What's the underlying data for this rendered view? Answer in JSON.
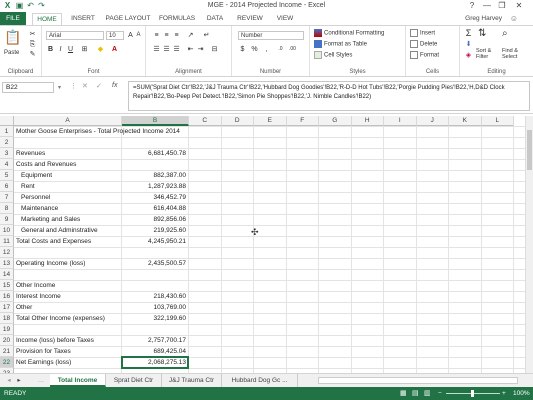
{
  "window": {
    "title": "MGE - 2014 Projected Income - Excel",
    "user": "Greg Harvey",
    "help": "?",
    "minimize": "—",
    "restore": "❐",
    "close": "✕"
  },
  "ribbon_tabs": [
    "FILE",
    "HOME",
    "INSERT",
    "PAGE LAYOUT",
    "FORMULAS",
    "DATA",
    "REVIEW",
    "VIEW"
  ],
  "ribbon": {
    "clipboard": {
      "paste": "Paste",
      "label": "Clipboard"
    },
    "font": {
      "name": "Arial",
      "size": "10",
      "label": "Font"
    },
    "alignment": {
      "label": "Alignment"
    },
    "number": {
      "format": "Number",
      "label": "Number"
    },
    "styles": {
      "conditional": "Conditional Formatting",
      "table": "Format as Table",
      "cell": "Cell Styles",
      "label": "Styles"
    },
    "cells": {
      "insert": "Insert",
      "delete": "Delete",
      "format": "Format",
      "label": "Cells"
    },
    "editing": {
      "sort": "Sort & Filter",
      "find": "Find & Select",
      "label": "Editing"
    }
  },
  "formula_bar": {
    "name_box": "B22",
    "fx": "fx",
    "formula": "=SUM('Sprat Diet Ctr'!B22,'J&J Trauma Ctr'!B22,'Hubbard Dog Goodies'!B22,'R-D-D Hot Tubs'!B22,'Porgie Pudding Pies'!B22,'H,D&D Clock Repair'!B22,'Bo-Peep Pet Detect.'!B22,'Simon Pie Shoppes'!B22,'J. Nimble Candles'!B22)"
  },
  "columns": [
    "A",
    "B",
    "C",
    "D",
    "E",
    "F",
    "G",
    "H",
    "I",
    "J",
    "K",
    "L"
  ],
  "rows": [
    {
      "n": "1",
      "a": "Mother Goose Enterprises - Total Projected Income 2014",
      "b": ""
    },
    {
      "n": "2",
      "a": "",
      "b": ""
    },
    {
      "n": "3",
      "a": "Revenues",
      "b": "6,681,450.78"
    },
    {
      "n": "4",
      "a": "Costs and Revenues",
      "b": ""
    },
    {
      "n": "5",
      "a": "Equipment",
      "b": "882,387.00",
      "indent": true
    },
    {
      "n": "6",
      "a": "Rent",
      "b": "1,287,923.88",
      "indent": true
    },
    {
      "n": "7",
      "a": "Personnel",
      "b": "346,452.79",
      "indent": true
    },
    {
      "n": "8",
      "a": "Maintenance",
      "b": "616,404.88",
      "indent": true
    },
    {
      "n": "9",
      "a": "Marketing and Sales",
      "b": "892,856.06",
      "indent": true
    },
    {
      "n": "10",
      "a": "General and Adminstrative",
      "b": "219,925.60",
      "indent": true
    },
    {
      "n": "11",
      "a": "Total Costs and Expenses",
      "b": "4,245,950.21"
    },
    {
      "n": "12",
      "a": "",
      "b": ""
    },
    {
      "n": "13",
      "a": "Operating Income (loss)",
      "b": "2,435,500.57"
    },
    {
      "n": "14",
      "a": "",
      "b": ""
    },
    {
      "n": "15",
      "a": "Other Income",
      "b": ""
    },
    {
      "n": "16",
      "a": "Interest Income",
      "b": "218,430.60"
    },
    {
      "n": "17",
      "a": "Other",
      "b": "103,769.00"
    },
    {
      "n": "18",
      "a": "Total Other Income (expenses)",
      "b": "322,199.60"
    },
    {
      "n": "19",
      "a": "",
      "b": ""
    },
    {
      "n": "20",
      "a": "Income (loss) before Taxes",
      "b": "2,757,700.17"
    },
    {
      "n": "21",
      "a": "Provision for Taxes",
      "b": "689,425.04"
    },
    {
      "n": "22",
      "a": "Net Earnings (loss)",
      "b": "2,068,275.13"
    },
    {
      "n": "23",
      "a": "",
      "b": ""
    }
  ],
  "sheet_tabs": [
    "Total Income",
    "Sprat Diet Ctr",
    "J&J Trauma Ctr",
    "Hubbard Dog Gc ..."
  ],
  "status": {
    "text": "READY",
    "zoom": "100%"
  },
  "colors": {
    "accent": "#217346"
  }
}
